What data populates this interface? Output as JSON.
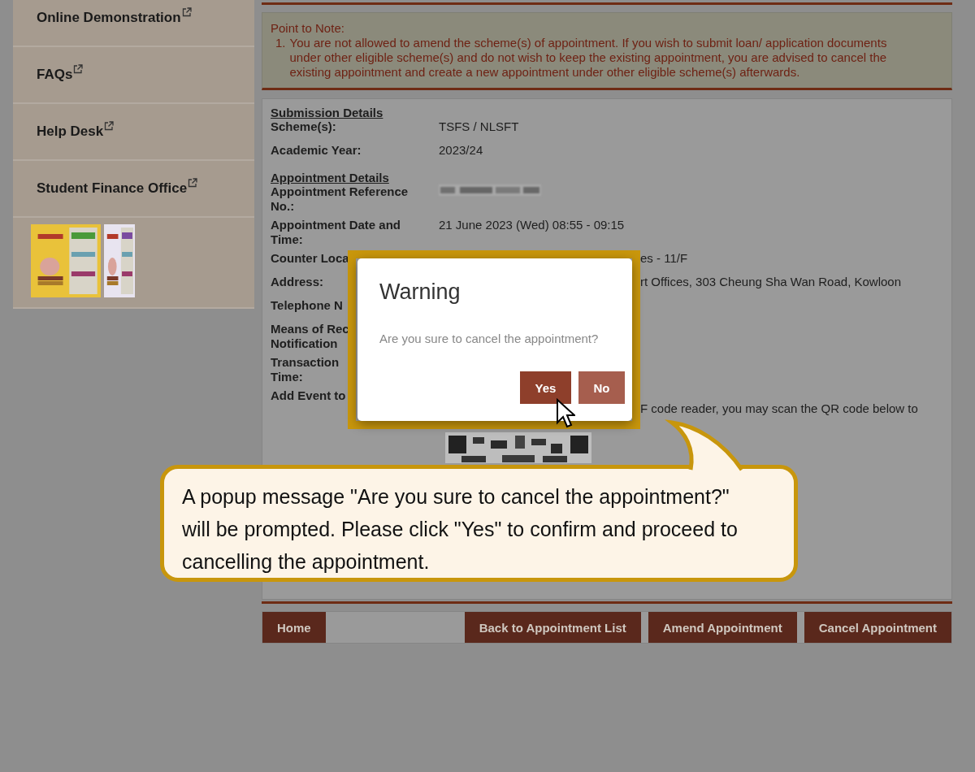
{
  "sidebar": {
    "items": [
      {
        "label": "Online Demonstration"
      },
      {
        "label": "FAQs"
      },
      {
        "label": "Help Desk"
      },
      {
        "label": "Student Finance Office"
      }
    ]
  },
  "note": {
    "title": "Point to Note:",
    "items": [
      {
        "number": "1.",
        "text": "You are not allowed to amend the scheme(s) of appointment. If you wish to submit loan/ application documents under other eligible scheme(s) and do not wish to keep the existing appointment, you are advised to cancel the existing appointment and create a new appointment under other eligible scheme(s) afterwards."
      }
    ]
  },
  "details": {
    "sections": [
      {
        "heading": "Submission Details",
        "rows": [
          {
            "kind": "plain",
            "label": "Scheme(s):",
            "value": "TSFS / NLSFT"
          },
          {
            "kind": "plain",
            "label": "Academic Year:",
            "value": "2023/24"
          }
        ]
      },
      {
        "heading": "Appointment Details",
        "rows": [
          {
            "kind": "blurred",
            "label": "Appointment Reference No.:"
          },
          {
            "kind": "plain",
            "label": "Appointment Date and Time:",
            "value": "21 June 2023 (Wed) 08:55 - 09:15"
          },
          {
            "kind": "cut",
            "label": "Counter Loca",
            "value": "es - 11/F"
          },
          {
            "kind": "cut",
            "label": "Address:",
            "value": "rt Offices, 303 Cheung Sha Wan Road, Kowloon"
          },
          {
            "kind": "plain",
            "label": "Telephone N"
          },
          {
            "kind": "plain",
            "label": "Means of Rec\nNotification"
          },
          {
            "kind": "plain",
            "label": "Transaction\nTime:"
          },
          {
            "kind": "qr",
            "label": "Add Event to",
            "value": "F code reader, you may scan the QR code below to"
          }
        ]
      }
    ]
  },
  "buttons": [
    {
      "label": "Home"
    },
    {
      "label": "Back to Appointment List"
    },
    {
      "label": "Amend Appointment"
    },
    {
      "label": "Cancel Appointment"
    }
  ],
  "dialog": {
    "title": "Warning",
    "message": "Are you sure to cancel the appointment?",
    "buttons": [
      {
        "label": "Yes",
        "highlighted": true
      },
      {
        "label": "No",
        "highlighted": false
      }
    ]
  },
  "callout": {
    "text": "A popup message \"Are you sure to cancel the appointment?\" will be prompted. Please click \"Yes\" to confirm and proceed to cancelling the appointment."
  }
}
